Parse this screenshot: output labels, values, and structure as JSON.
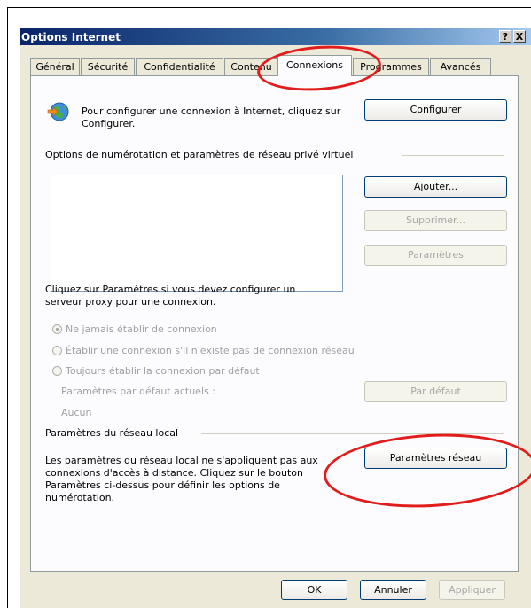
{
  "window": {
    "title": "Options Internet",
    "help_label": "?",
    "close_label": "X"
  },
  "tabs": [
    {
      "label": "Général"
    },
    {
      "label": "Sécurité"
    },
    {
      "label": "Confidentialité"
    },
    {
      "label": "Contenu"
    },
    {
      "label": "Connexions"
    },
    {
      "label": "Programmes"
    },
    {
      "label": "Avancés"
    }
  ],
  "connection": {
    "setup_text": "Pour configurer une connexion à Internet, cliquez sur Configurer.",
    "configure_button": "Configurer"
  },
  "dialup": {
    "heading": "Options de numérotation et paramètres de réseau privé virtuel",
    "add_button": "Ajouter...",
    "remove_button": "Supprimer...",
    "settings_button": "Paramètres",
    "proxy_text": "Cliquez sur Paramètres si vous devez configurer un serveur proxy pour une connexion.",
    "options": [
      {
        "label": "Ne jamais établir de connexion",
        "checked": true
      },
      {
        "label": "Établir une connexion s'il n'existe pas de connexion réseau",
        "checked": false
      },
      {
        "label": "Toujours établir la connexion par défaut",
        "checked": false
      }
    ],
    "current_default_label": "Paramètres par défaut actuels :",
    "current_default_value": "Aucun",
    "set_default_button": "Par défaut"
  },
  "lan": {
    "heading": "Paramètres du réseau local",
    "text": "Les paramètres du réseau local ne s'appliquent pas aux connexions d'accès à distance. Cliquez sur le bouton Paramètres ci-dessus pour définir les options de numérotation.",
    "lan_button": "Paramètres réseau"
  },
  "footer": {
    "ok": "OK",
    "cancel": "Annuler",
    "apply": "Appliquer"
  },
  "colors": {
    "annotation": "#e21b1b",
    "titlebar": "#0a246a"
  },
  "icons": {
    "connection_wizard": "globe-arrow-icon"
  }
}
